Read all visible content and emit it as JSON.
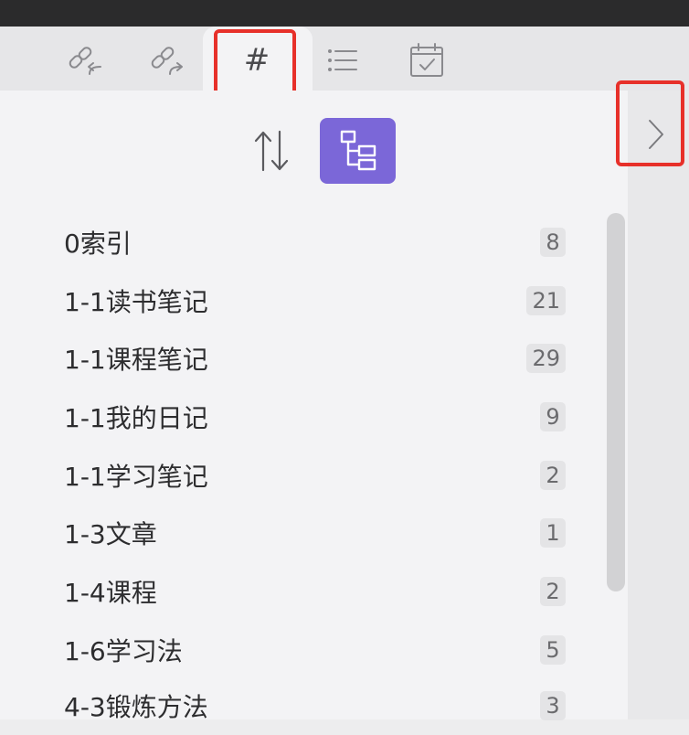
{
  "tabs": [
    {
      "name": "backlinks",
      "icon": "link-backward-icon"
    },
    {
      "name": "outgoing-links",
      "icon": "link-forward-icon"
    },
    {
      "name": "tags",
      "icon": "hash-icon",
      "label": "#"
    },
    {
      "name": "outline",
      "icon": "list-icon"
    },
    {
      "name": "calendar",
      "icon": "calendar-check-icon"
    }
  ],
  "toolbar": {
    "sort_icon": "sort-arrows-icon",
    "tree_icon": "tree-view-icon"
  },
  "tags": [
    {
      "label": "0索引",
      "count": "8"
    },
    {
      "label": "1-1读书笔记",
      "count": "21"
    },
    {
      "label": "1-1课程笔记",
      "count": "29"
    },
    {
      "label": "1-1我的日记",
      "count": "9"
    },
    {
      "label": "1-1学习笔记",
      "count": "2"
    },
    {
      "label": "1-3文章",
      "count": "1"
    },
    {
      "label": "1-4课程",
      "count": "2"
    },
    {
      "label": "1-6学习法",
      "count": "5"
    },
    {
      "label": "4-3锻炼方法",
      "count": "3"
    }
  ],
  "colors": {
    "accent": "#7b67d8",
    "highlight": "#e7302a"
  }
}
